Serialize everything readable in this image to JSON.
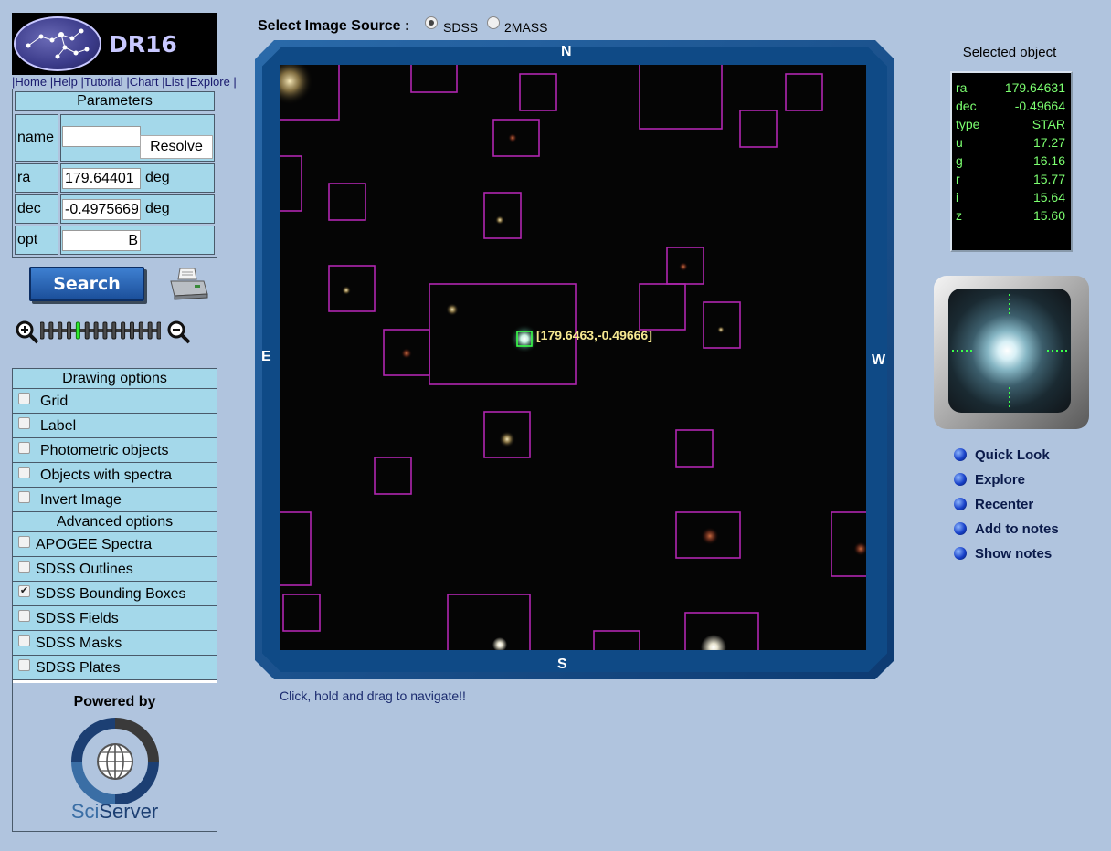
{
  "logo": {
    "text": "DR16"
  },
  "topnav": [
    "Home",
    "Help",
    "Tutorial",
    "Chart",
    "List",
    "Explore"
  ],
  "params": {
    "title": "Parameters",
    "name_label": "name",
    "name_value": "",
    "resolve_label": "Resolve",
    "ra_label": "ra",
    "ra_value": "179.64401",
    "ra_unit": "deg",
    "dec_label": "dec",
    "dec_value": "-0.4975669",
    "dec_unit": "deg",
    "opt_label": "opt",
    "opt_value": "B"
  },
  "search_label": "Search",
  "icons": {
    "print": "print-icon",
    "zoom_in": "zoom-in-icon",
    "zoom_out": "zoom-out-icon"
  },
  "zoom": {
    "ticks": 14,
    "selected_index": 4
  },
  "drawing": {
    "title": "Drawing options",
    "options": [
      {
        "label": "Grid",
        "checked": false
      },
      {
        "label": "Label",
        "checked": false
      },
      {
        "label": "Photometric objects",
        "checked": false
      },
      {
        "label": "Objects with spectra",
        "checked": false
      },
      {
        "label": "Invert Image",
        "checked": false
      }
    ],
    "advanced_title": "Advanced options",
    "advanced": [
      {
        "label": "APOGEE Spectra",
        "checked": false
      },
      {
        "label": "SDSS Outlines",
        "checked": false
      },
      {
        "label": "SDSS Bounding Boxes",
        "checked": true
      },
      {
        "label": "SDSS Fields",
        "checked": false
      },
      {
        "label": "SDSS Masks",
        "checked": false
      },
      {
        "label": "SDSS Plates",
        "checked": false
      }
    ]
  },
  "powered": {
    "label": "Powered by",
    "brand_a": "Sci",
    "brand_b": "Server"
  },
  "source": {
    "label": "Select Image Source :",
    "options": [
      "SDSS",
      "2MASS"
    ],
    "selected": "SDSS"
  },
  "compass": {
    "n": "N",
    "s": "S",
    "e": "E",
    "w": "W"
  },
  "marker_label": "[179.6463,-0.49666]",
  "hint": "Click, hold and drag to navigate!!",
  "selected": {
    "title": "Selected object",
    "rows": [
      {
        "k": "ra",
        "v": "179.64631"
      },
      {
        "k": "dec",
        "v": "-0.49664"
      },
      {
        "k": "type",
        "v": "STAR"
      },
      {
        "k": "u",
        "v": "17.27"
      },
      {
        "k": "g",
        "v": "16.16"
      },
      {
        "k": "r",
        "v": "15.77"
      },
      {
        "k": "i",
        "v": "15.64"
      },
      {
        "k": "z",
        "v": "15.60"
      }
    ]
  },
  "actions": [
    "Quick Look",
    "Explore",
    "Recenter",
    "Add to notes",
    "Show notes"
  ],
  "colors": {
    "background": "#b0c4de",
    "panel": "#a4d8ea",
    "box": "#b026b0",
    "readout": "#7cff70"
  }
}
